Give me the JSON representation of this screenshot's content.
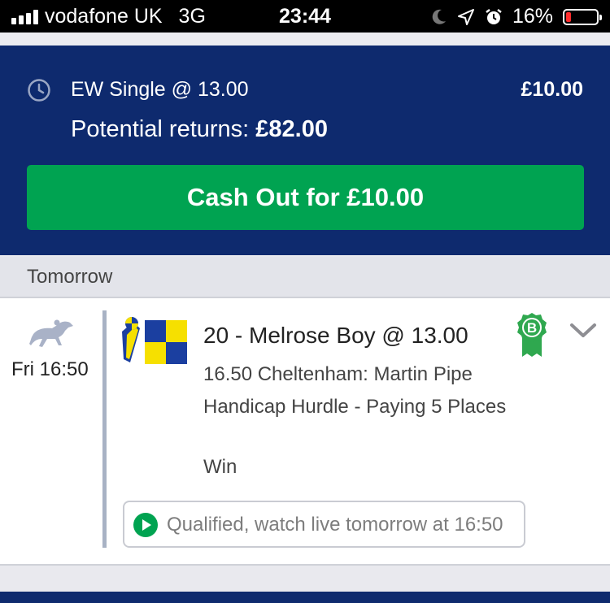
{
  "status_bar": {
    "carrier": "vodafone UK",
    "network": "3G",
    "time": "23:44",
    "battery": "16%",
    "battery_level": 0.16,
    "icons": [
      "signal-icon",
      "moon-icon",
      "location-arrow-icon",
      "alarm-icon",
      "battery-icon"
    ]
  },
  "bet": {
    "type": "EW Single @ 13.00",
    "stake": "£10.00",
    "returns_label": "Potential returns:",
    "returns_value": "£82.00",
    "cashout_label": "Cash Out for £10.00"
  },
  "section": {
    "title": "Tomorrow"
  },
  "selection": {
    "race_time": "Fri 16:50",
    "name": "20 - Melrose Boy @ 13.00",
    "market": "16.50 Cheltenham: Martin Pipe Handicap Hurdle - Paying 5 Places",
    "result": "Win",
    "badge": "B",
    "stream_text": "Qualified, watch live tomorrow at 16:50"
  },
  "colors": {
    "header_bg": "#0e2a6e",
    "cashout_green": "#00a351",
    "badge_green": "#2fa84f",
    "silks_blue": "#1b3fa0",
    "silks_yellow": "#f6e000"
  }
}
